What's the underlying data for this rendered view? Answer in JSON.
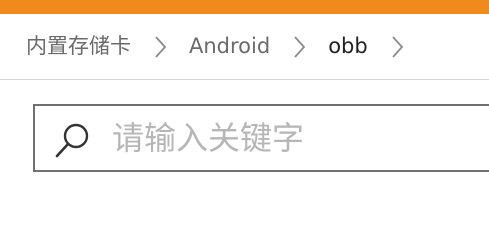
{
  "colors": {
    "accent_bar": "#f08a1c",
    "breadcrumb_text": "#6a6a6a",
    "breadcrumb_current": "#222222",
    "border": "#707070",
    "placeholder": "#b6b6b6"
  },
  "breadcrumb": {
    "items": [
      {
        "label": "内置存储卡"
      },
      {
        "label": "Android"
      },
      {
        "label": "obb"
      }
    ],
    "separator_icon": "chevron-right-icon"
  },
  "search": {
    "icon": "search-icon",
    "placeholder": "请输入关键字",
    "value": ""
  }
}
